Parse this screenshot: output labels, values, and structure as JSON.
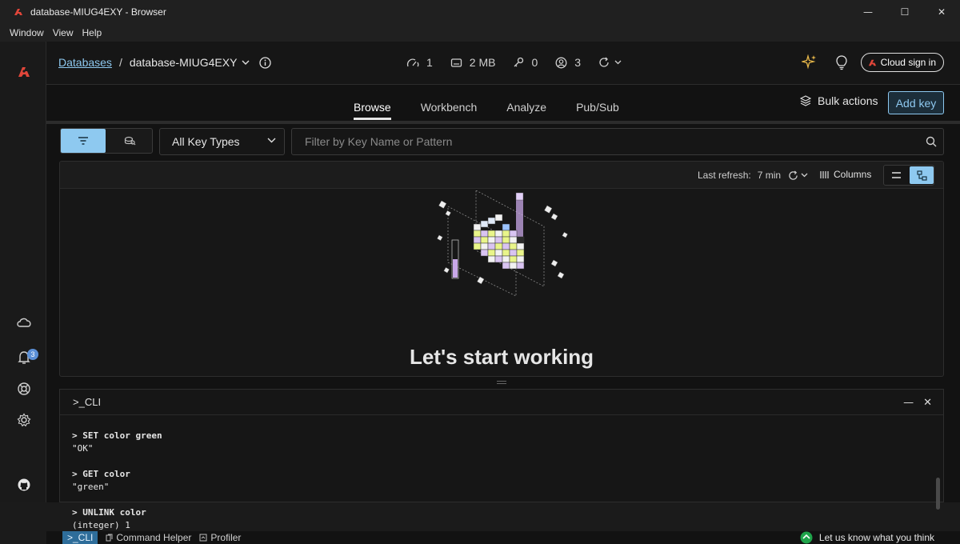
{
  "window": {
    "title": "database-MIUG4EXY - Browser",
    "controls": [
      "—",
      "☐",
      "✕"
    ]
  },
  "menu": [
    "Window",
    "View",
    "Help"
  ],
  "breadcrumb": {
    "root": "Databases",
    "separator": "/",
    "current": "database-MIUG4EXY"
  },
  "stats": [
    {
      "icon": "gauge-icon",
      "value": "1"
    },
    {
      "icon": "memory-icon",
      "value": "2 MB"
    },
    {
      "icon": "key-icon",
      "value": "0"
    },
    {
      "icon": "user-icon",
      "value": "3"
    }
  ],
  "header": {
    "cloud_sign_in": "Cloud sign in"
  },
  "tabs": [
    {
      "label": "Browse",
      "active": true
    },
    {
      "label": "Workbench",
      "active": false
    },
    {
      "label": "Analyze",
      "active": false
    },
    {
      "label": "Pub/Sub",
      "active": false
    }
  ],
  "actions": {
    "bulk": "Bulk actions",
    "add_key": "Add key"
  },
  "filter": {
    "key_type": "All Key Types",
    "search_placeholder": "Filter by Key Name or Pattern"
  },
  "panel": {
    "refresh_label": "Last refresh:",
    "refresh_value": "7 min",
    "columns_label": "Columns",
    "welcome": "Let's start working"
  },
  "cli": {
    "title": ">_CLI",
    "lines": [
      {
        "text": "> SET color green",
        "cmd": true
      },
      {
        "text": "\"OK\"",
        "cmd": false
      },
      {
        "text": "",
        "cmd": false
      },
      {
        "text": "> GET color",
        "cmd": true
      },
      {
        "text": "\"green\"",
        "cmd": false
      },
      {
        "text": "",
        "cmd": false
      },
      {
        "text": "> UNLINK color",
        "cmd": true
      },
      {
        "text": "(integer) 1",
        "cmd": false
      }
    ]
  },
  "bottombar": {
    "cli": ">_CLI",
    "command_helper": "Command Helper",
    "profiler": "Profiler",
    "feedback": "Let us know what you think"
  },
  "notifications": {
    "count": "3"
  },
  "colors": {
    "accent": "#8ec9f0",
    "brand": "#d8342b",
    "background": "#121212"
  }
}
